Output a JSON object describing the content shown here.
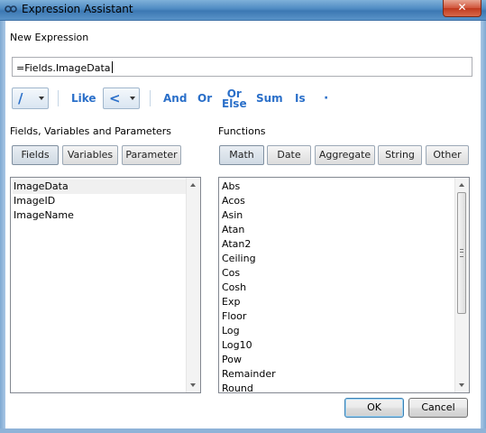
{
  "window": {
    "title": "Expression Assistant",
    "close_label": "✕"
  },
  "expression": {
    "label": "New Expression",
    "value": "=Fields.ImageData"
  },
  "operators": {
    "arithmetic_selected": "/",
    "like": "Like",
    "comparison_selected": "<",
    "and": "And",
    "or": "Or",
    "or_else_line1": "Or",
    "or_else_line2": "Else",
    "sum": "Sum",
    "is": "Is",
    "concat": "·"
  },
  "fields_panel": {
    "label": "Fields, Variables and Parameters",
    "tabs": [
      "Fields",
      "Variables",
      "Parameter"
    ],
    "active_tab": "Fields",
    "items": [
      "ImageData",
      "ImageID",
      "ImageName"
    ],
    "selected_item": "ImageData"
  },
  "functions_panel": {
    "label": "Functions",
    "tabs": [
      "Math",
      "Date",
      "Aggregate",
      "String",
      "Other"
    ],
    "active_tab": "Math",
    "items": [
      "Abs",
      "Acos",
      "Asin",
      "Atan",
      "Atan2",
      "Ceiling",
      "Cos",
      "Cosh",
      "Exp",
      "Floor",
      "Log",
      "Log10",
      "Pow",
      "Remainder",
      "Round"
    ]
  },
  "buttons": {
    "ok": "OK",
    "cancel": "Cancel"
  },
  "colors": {
    "operator_blue": "#2a6fc9",
    "titlebar": "#4e8ac2",
    "close_red": "#c0391d"
  }
}
